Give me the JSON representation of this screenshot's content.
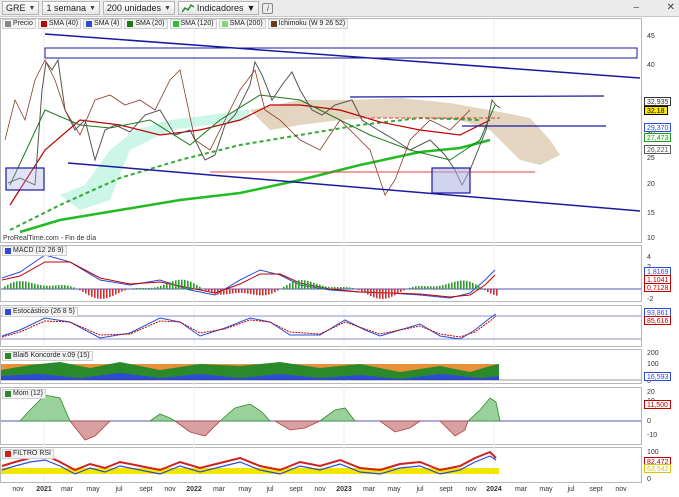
{
  "toolbar": {
    "symbol": "GRE",
    "interval": "1 semana",
    "units": "200 unidades",
    "indicators_label": "Indicadores",
    "info_label": "i",
    "minimize_glyph": "–",
    "close_glyph": "✕"
  },
  "price_legend": [
    {
      "label": "Precio",
      "color": "#888888"
    },
    {
      "label": "SMA (40)",
      "color": "#c00000"
    },
    {
      "label": "SMA (4)",
      "color": "#2b4bd8"
    },
    {
      "label": "SMA (20)",
      "color": "#1a7a1a"
    },
    {
      "label": "SMA (120)",
      "color": "#33bb33"
    },
    {
      "label": "SMA (200)",
      "color": "#7fd87f"
    },
    {
      "label": "Ichimoku (W 9 26 52)",
      "color": "#6b3a1a"
    }
  ],
  "price_axis": [
    "45",
    "40",
    "35",
    "30",
    "25",
    "20",
    "15",
    "10"
  ],
  "price_tags": [
    {
      "value": "32,935",
      "color": "#333333",
      "bg": "#ffffff"
    },
    {
      "value": "32,18",
      "color": "#000000",
      "bg": "#ffe800"
    },
    {
      "value": "29,370",
      "color": "#2b4bd8",
      "bg": "#ffffff"
    },
    {
      "value": "27,473",
      "color": "#1a9a1a",
      "bg": "#ffffff"
    },
    {
      "value": "26,221",
      "color": "#555555",
      "bg": "#ffffff"
    }
  ],
  "watermark": "ProRealTime.com - Fin de día",
  "macd": {
    "label": "MACD (12 26 9)",
    "axis": [
      "4",
      "2",
      "0",
      "-2"
    ],
    "tags": [
      {
        "value": "1,8169",
        "color": "#2b4bd8"
      },
      {
        "value": "1,1041",
        "color": "#c00000"
      },
      {
        "value": "0,7128",
        "color": "#c00000"
      }
    ]
  },
  "stoch": {
    "label": "Estocástico (26 8 5)",
    "tags": [
      {
        "value": "93,861",
        "color": "#2b4bd8"
      },
      {
        "value": "85,616",
        "color": "#c00000"
      }
    ]
  },
  "koncorde": {
    "label": "Blai5 Koncorde v.09 (15)",
    "axis": [
      "200",
      "100",
      "0"
    ],
    "tags": [
      {
        "value": "16,593",
        "color": "#2b4bd8"
      }
    ]
  },
  "mom": {
    "label": "Mom (12)",
    "axis": [
      "20",
      "10",
      "0",
      "-10"
    ],
    "tags": [
      {
        "value": "11,500",
        "color": "#c00000"
      }
    ]
  },
  "rsi": {
    "label": "FILTRO RSI",
    "axis": [
      "100",
      "0"
    ],
    "tags": [
      {
        "value": "82,472",
        "color": "#c00000"
      },
      {
        "value": "63,542",
        "color": "#d8c400"
      }
    ]
  },
  "time_axis": [
    {
      "label": "nov",
      "bold": false
    },
    {
      "label": "2021",
      "bold": true
    },
    {
      "label": "mar",
      "bold": false
    },
    {
      "label": "may",
      "bold": false
    },
    {
      "label": "jul",
      "bold": false
    },
    {
      "label": "sept",
      "bold": false
    },
    {
      "label": "nov",
      "bold": false
    },
    {
      "label": "2022",
      "bold": true
    },
    {
      "label": "mar",
      "bold": false
    },
    {
      "label": "may",
      "bold": false
    },
    {
      "label": "jul",
      "bold": false
    },
    {
      "label": "sept",
      "bold": false
    },
    {
      "label": "nov",
      "bold": false
    },
    {
      "label": "2023",
      "bold": true
    },
    {
      "label": "mar",
      "bold": false
    },
    {
      "label": "may",
      "bold": false
    },
    {
      "label": "jul",
      "bold": false
    },
    {
      "label": "sept",
      "bold": false
    },
    {
      "label": "nov",
      "bold": false
    },
    {
      "label": "2024",
      "bold": true
    },
    {
      "label": "mar",
      "bold": false
    },
    {
      "label": "may",
      "bold": false
    },
    {
      "label": "jul",
      "bold": false
    },
    {
      "label": "sept",
      "bold": false
    },
    {
      "label": "nov",
      "bold": false
    }
  ]
}
